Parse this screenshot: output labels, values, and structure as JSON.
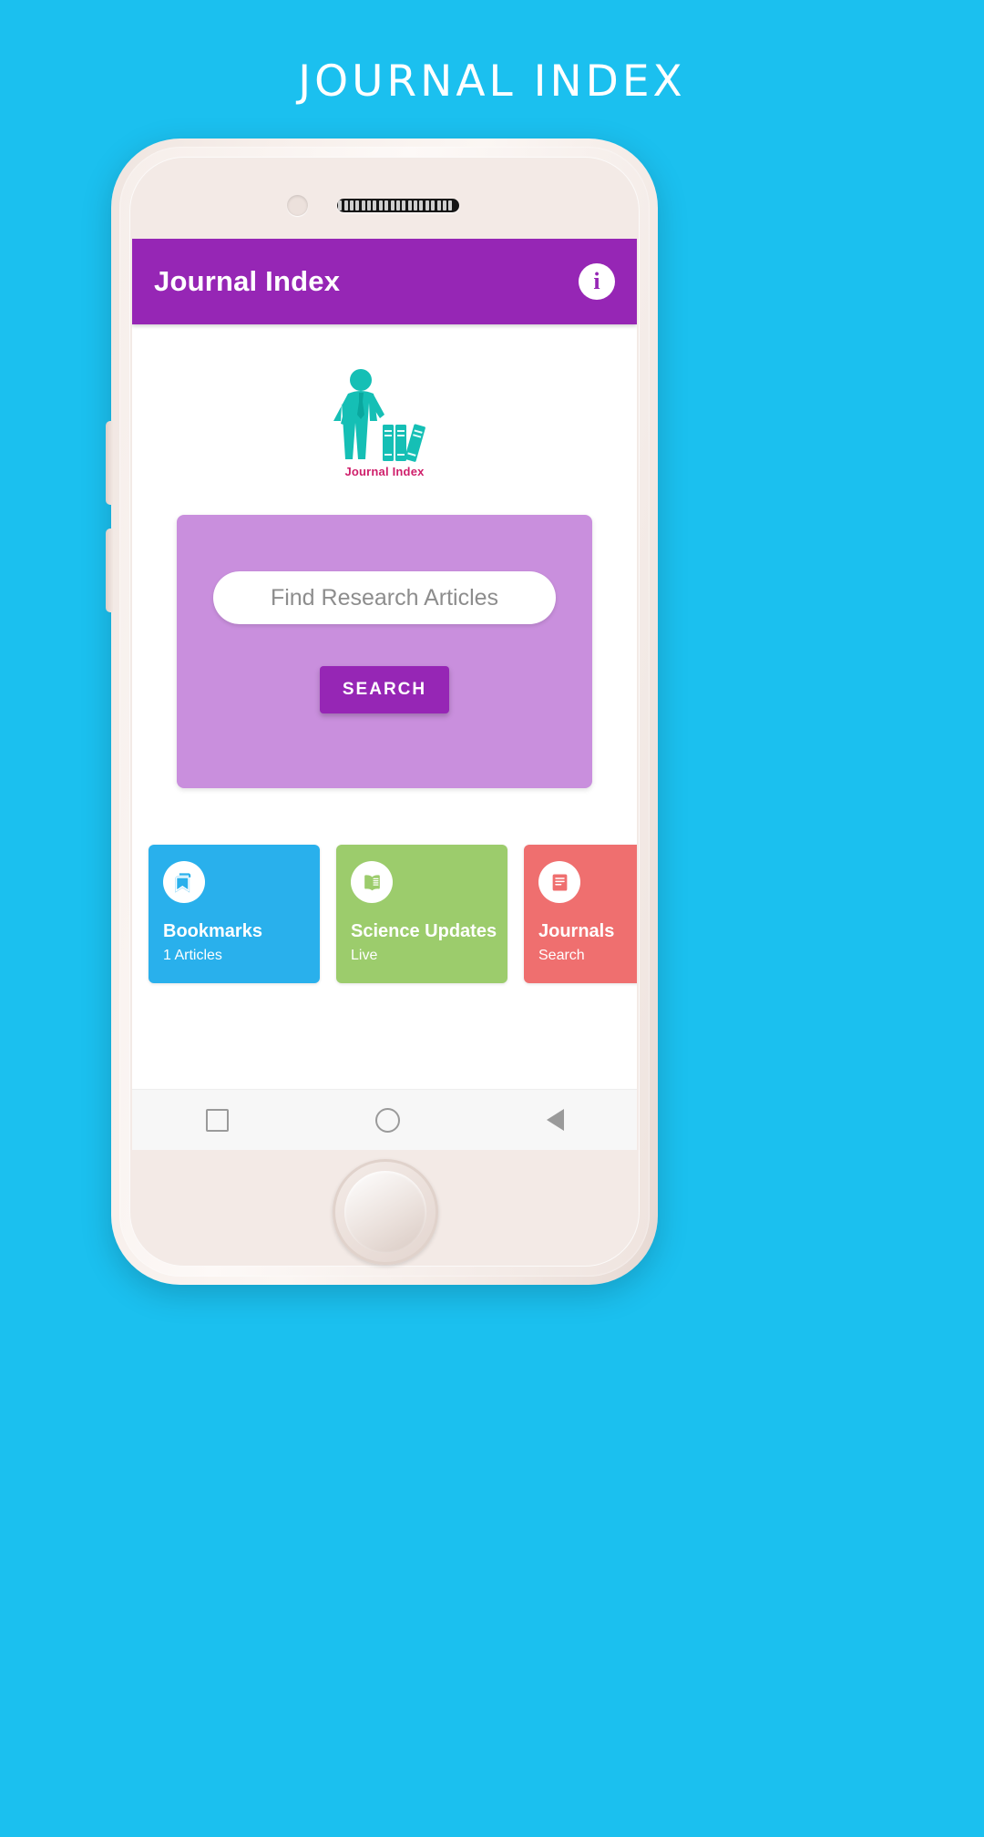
{
  "page": {
    "title": "Journal Index",
    "background_color": "#1bc0ef"
  },
  "appbar": {
    "title": "Journal Index",
    "background_color": "#9626b5",
    "info_icon": "info-icon",
    "info_glyph": "i"
  },
  "logo": {
    "caption": "Journal Index",
    "caption_color": "#cf1f6b",
    "figure_color": "#15bfb5",
    "icon_name": "person-with-books-logo"
  },
  "search": {
    "card_color": "#c98fdd",
    "placeholder": "Find Research Articles",
    "value": "",
    "button_label": "SEARCH",
    "button_color": "#9626b5"
  },
  "tiles": [
    {
      "title": "Bookmarks",
      "subtitle": "1 Articles",
      "color": "#29b0ec",
      "icon": "bookmarks-icon"
    },
    {
      "title": "Science Updates",
      "subtitle": "Live",
      "color": "#9ccc6c",
      "icon": "open-book-icon"
    },
    {
      "title": "Journals",
      "subtitle": "Search",
      "color": "#ef6f6f",
      "icon": "journals-icon"
    }
  ],
  "navbar": {
    "recent_label": "recents",
    "home_label": "home",
    "back_label": "back"
  }
}
